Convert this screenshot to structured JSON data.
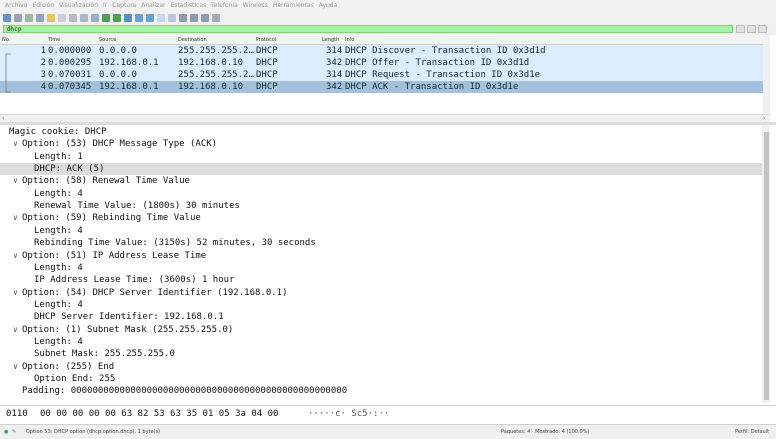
{
  "menu": [
    "Archivo",
    "Edición",
    "Visualización",
    "Ir",
    "Captura",
    "Analizar",
    "Estadísticas",
    "Telefonía",
    "Wireless",
    "Herramientas",
    "Ayuda"
  ],
  "filter": {
    "value": "dhcp"
  },
  "packet_list": {
    "columns": [
      "No.",
      "Time",
      "Source",
      "Destination",
      "Protocol",
      "Length",
      "Info"
    ],
    "rows": [
      {
        "no": "1",
        "time": "0.000000",
        "source": "0.0.0.0",
        "destination": "255.255.255.2…",
        "protocol": "DHCP",
        "length": "314",
        "info": "DHCP Discover - Transaction ID 0x3d1d"
      },
      {
        "no": "2",
        "time": "0.000295",
        "source": "192.168.0.1",
        "destination": "192.168.0.10",
        "protocol": "DHCP",
        "length": "342",
        "info": "DHCP Offer    - Transaction ID 0x3d1d"
      },
      {
        "no": "3",
        "time": "0.070031",
        "source": "0.0.0.0",
        "destination": "255.255.255.2…",
        "protocol": "DHCP",
        "length": "314",
        "info": "DHCP Request  - Transaction ID 0x3d1e"
      },
      {
        "no": "4",
        "time": "0.070345",
        "source": "192.168.0.1",
        "destination": "192.168.0.10",
        "protocol": "DHCP",
        "length": "342",
        "info": "DHCP ACK      - Transaction ID 0x3d1e"
      }
    ]
  },
  "details": [
    {
      "text": "Magic cookie: DHCP",
      "level": 0,
      "toggle": ""
    },
    {
      "text": "Option: (53) DHCP Message Type (ACK)",
      "level": 0,
      "toggle": "v"
    },
    {
      "text": "Length: 1",
      "level": 1,
      "toggle": ""
    },
    {
      "text": "DHCP: ACK (5)",
      "level": 1,
      "toggle": ""
    },
    {
      "text": "Option: (58) Renewal Time Value",
      "level": 0,
      "toggle": "v"
    },
    {
      "text": "Length: 4",
      "level": 1,
      "toggle": ""
    },
    {
      "text": "Renewal Time Value: (1800s) 30 minutes",
      "level": 1,
      "toggle": ""
    },
    {
      "text": "Option: (59) Rebinding Time Value",
      "level": 0,
      "toggle": "v"
    },
    {
      "text": "Length: 4",
      "level": 1,
      "toggle": ""
    },
    {
      "text": "Rebinding Time Value: (3150s) 52 minutes, 30 seconds",
      "level": 1,
      "toggle": ""
    },
    {
      "text": "Option: (51) IP Address Lease Time",
      "level": 0,
      "toggle": "v"
    },
    {
      "text": "Length: 4",
      "level": 1,
      "toggle": ""
    },
    {
      "text": "IP Address Lease Time: (3600s) 1 hour",
      "level": 1,
      "toggle": ""
    },
    {
      "text": "Option: (54) DHCP Server Identifier (192.168.0.1)",
      "level": 0,
      "toggle": "v"
    },
    {
      "text": "Length: 4",
      "level": 1,
      "toggle": ""
    },
    {
      "text": "DHCP Server Identifier: 192.168.0.1",
      "level": 1,
      "toggle": ""
    },
    {
      "text": "Option: (1) Subnet Mask (255.255.255.0)",
      "level": 0,
      "toggle": "v"
    },
    {
      "text": "Length: 4",
      "level": 1,
      "toggle": ""
    },
    {
      "text": "Subnet Mask: 255.255.255.0",
      "level": 1,
      "toggle": ""
    },
    {
      "text": "Option: (255) End",
      "level": 0,
      "toggle": "v"
    },
    {
      "text": "Option End: 255",
      "level": 1,
      "toggle": ""
    },
    {
      "text": "Padding: 000000000000000000000000000000000000000000000000000",
      "level": 0,
      "toggle": ""
    }
  ],
  "selected_detail": 3,
  "bytes": {
    "offset": "0110",
    "hex": "00 00 00 00 00 63 82  53 63 35 01 05 3a 04 00",
    "ascii": "·····c· Sc5·:··"
  },
  "status": {
    "left": "Option 53: DHCP option (dhcp.option.dhcp), 1 byte(s)",
    "packets": "Paquetes: 4 · Mostrado: 4 (100.0%)",
    "profile": "Perfil: Default"
  },
  "colors": {
    "row_udp": "#daeeff",
    "row_selected": "#a3c1de",
    "filter_ok": "#a9f2a5",
    "detail_selected": "#dcdcdc"
  }
}
